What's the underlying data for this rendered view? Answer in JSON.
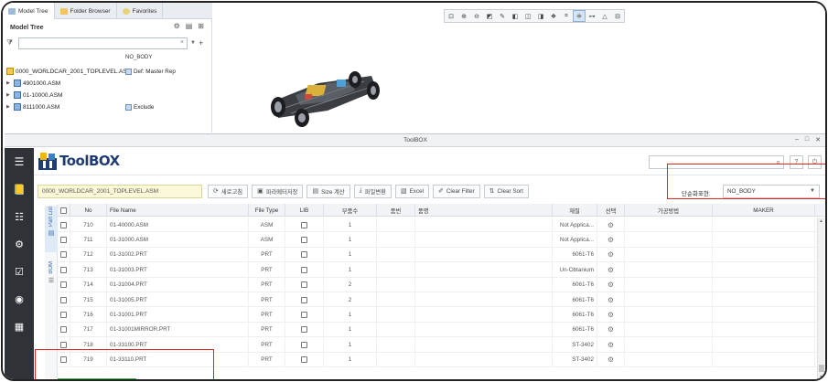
{
  "creo": {
    "tabs": [
      {
        "label": "Model Tree",
        "icon": "model-tree-icon"
      },
      {
        "label": "Folder Browser",
        "icon": "folder-icon"
      },
      {
        "label": "Favorites",
        "icon": "favorites-icon"
      }
    ],
    "panel_title": "Model Tree",
    "column_header": "NO_BODY",
    "tree": [
      {
        "label": "0000_WORLDCAR_2001_TOPLEVEL.ASM",
        "side": "Def: Master Rep",
        "expander": false
      },
      {
        "label": "4901000.ASM",
        "side": "",
        "expander": true
      },
      {
        "label": "01-10000.ASM",
        "side": "",
        "expander": true
      },
      {
        "label": "8111000.ASM",
        "side": "Exclude",
        "expander": true
      }
    ],
    "view_toolbar": [
      "refit-icon",
      "zoom-in-icon",
      "zoom-out-icon",
      "repaint-icon",
      "pan-icon",
      "view-manager-icon",
      "saved-views-icon",
      "display-style-icon",
      "named-view-icon",
      "datum-display-icon",
      "spin-center-icon",
      "annotation-icon",
      "section-icon"
    ]
  },
  "toolbox": {
    "window_title": "ToolBOX",
    "window_controls": [
      "–",
      "□",
      "✕"
    ],
    "logo_text": "ToolBOX",
    "search_placeholder": "",
    "header_buttons": [
      "?",
      "⏻"
    ],
    "asm_name": "0000_WORLDCAR_2001_TOPLEVEL.ASM",
    "toolbar": {
      "refresh": "새로고침",
      "save_params": "파라메터저장",
      "size_calc": "Size 계산",
      "file_convert": "파일변환",
      "excel": "Excel",
      "clear_filter": "Clear Filter",
      "clear_sort": "Clear Sort"
    },
    "display_label": "단순화표현:",
    "display_value": "NO_BODY",
    "vtabs": [
      "Part List",
      "BOM"
    ],
    "columns": {
      "no": "No",
      "file_name": "File Name",
      "file_type": "File Type",
      "lib": "LIB",
      "qty": "부품수",
      "part_no": "품번",
      "part_name": "품명",
      "material": "재질",
      "select": "선택",
      "process": "가공방법",
      "maker": "MAKER"
    },
    "rows": [
      {
        "no": "710",
        "file": "01-40000.ASM",
        "type": "ASM",
        "qty": "1",
        "material": "Not Applica..."
      },
      {
        "no": "711",
        "file": "01-31000.ASM",
        "type": "ASM",
        "qty": "1",
        "material": "Not Applica..."
      },
      {
        "no": "712",
        "file": "01-31002.PRT",
        "type": "PRT",
        "qty": "1",
        "material": "6061-T6"
      },
      {
        "no": "713",
        "file": "01-31003.PRT",
        "type": "PRT",
        "qty": "1",
        "material": "Un-Obtanium"
      },
      {
        "no": "714",
        "file": "01-31004.PRT",
        "type": "PRT",
        "qty": "2",
        "material": "6061-T6"
      },
      {
        "no": "715",
        "file": "01-31005.PRT",
        "type": "PRT",
        "qty": "2",
        "material": "6061-T6"
      },
      {
        "no": "716",
        "file": "01-31001.PRT",
        "type": "PRT",
        "qty": "1",
        "material": "6061-T6"
      },
      {
        "no": "717",
        "file": "01-31001MIRROR.PRT",
        "type": "PRT",
        "qty": "1",
        "material": "6061-T6"
      },
      {
        "no": "718",
        "file": "01-33100.PRT",
        "type": "PRT",
        "qty": "1",
        "material": "ST-3402"
      },
      {
        "no": "719",
        "file": "01-33110.PRT",
        "type": "PRT",
        "qty": "1",
        "material": "ST-3402"
      }
    ],
    "highlight_color": "#e02424"
  }
}
